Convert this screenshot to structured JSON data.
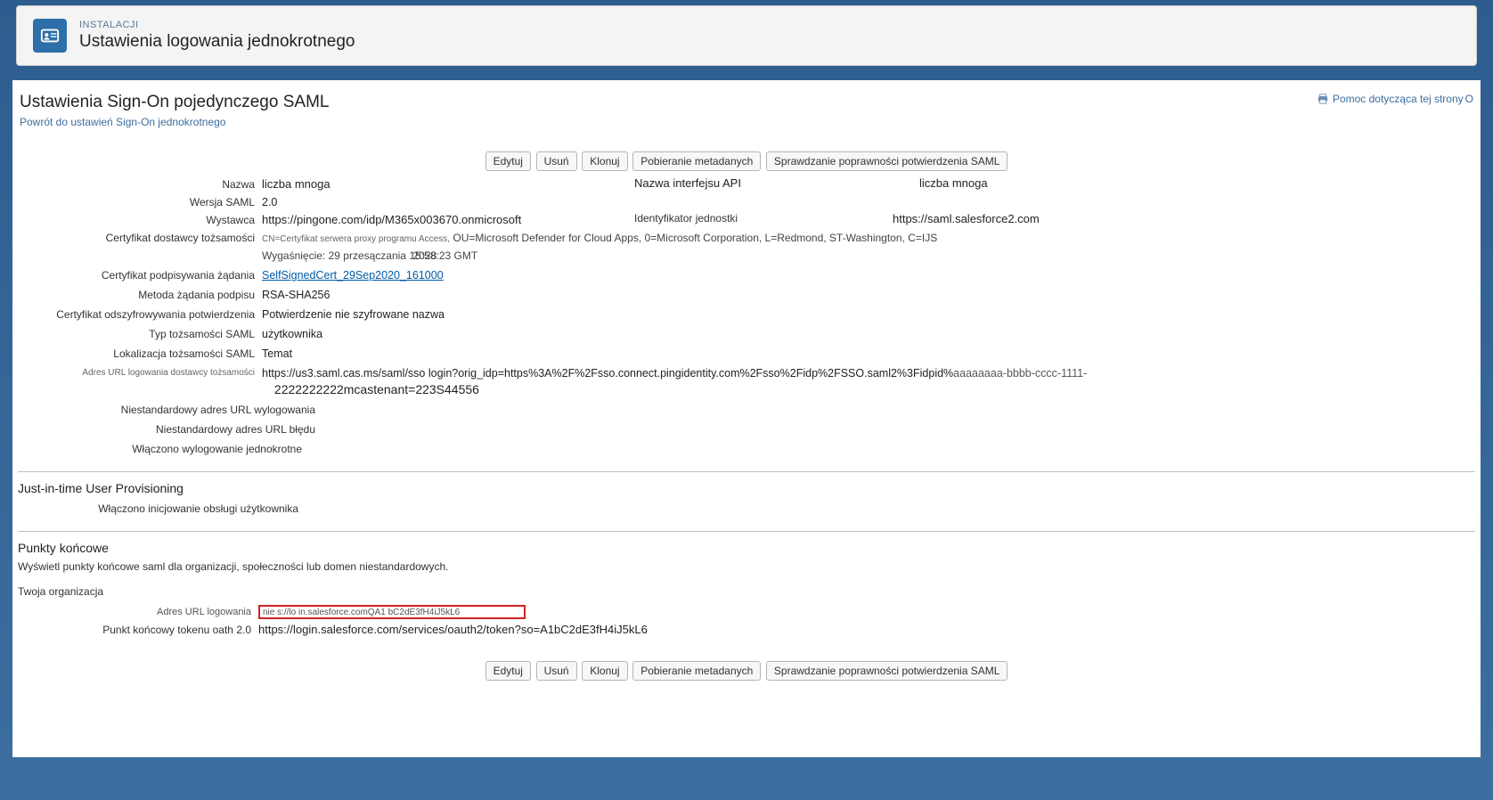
{
  "header": {
    "super": "INSTALACJI",
    "title": "Ustawienia logowania jednokrotnego"
  },
  "page": {
    "title": "Ustawienia Sign-On pojedynczego SAML",
    "back": "Powrót do ustawień Sign-On jednokrotnego",
    "help": "Pomoc dotycząca tej strony"
  },
  "buttons": {
    "edit": "Edytuj",
    "delete": "Usuń",
    "clone": "Klonuj",
    "download": "Pobieranie metadanych",
    "validate": "Sprawdzanie poprawności potwierdzenia SAML"
  },
  "fields": {
    "name_label": "Nazwa",
    "name_value": "liczba mnoga",
    "api_name_label": "Nazwa interfejsu API",
    "api_name_value": "liczba mnoga",
    "version_label": "Wersja SAML",
    "version_value": "2.0",
    "issuer_label": "Wystawca",
    "issuer_value": "https://pingone.com/idp/M365x003670.onmicrosoft",
    "entity_id_label": "Identyfikator jednostki",
    "entity_id_value": "https://saml.salesforce2.com",
    "idp_cert_label": "Certyfikat dostawcy tożsamości",
    "idp_cert_cn": "CN=Certyfikat serwera proxy programu Access,",
    "idp_cert_rest": "OU=Microsoft Defender for Cloud Apps, 0=Microsoft Corporation, L=Redmond, ST-Washington, C=IJS",
    "idp_cert_expiry_prefix": "Wygaśnięcie: 29 przesączania",
    "idp_cert_expiry_mid": "15:58:23 GMT",
    "idp_cert_expiry_year": "2028",
    "req_sign_cert_label": "Certyfikat podpisywania żądania",
    "req_sign_cert_value": "SelfSignedCert_29Sep2020_161000",
    "req_sig_method_label": "Metoda żądania podpisu",
    "req_sig_method_value": "RSA-SHA256",
    "assertion_decrypt_label": "Certyfikat odszyfrowywania potwierdzenia",
    "assertion_decrypt_value": "Potwierdzenie nie szyfrowane nazwa",
    "identity_type_label": "Typ tożsamości SAML",
    "identity_type_value": "użytkownika",
    "identity_loc_label": "Lokalizacja tożsamości SAML",
    "identity_loc_value": "Temat",
    "login_url_label": "Adres URL logowania dostawcy tożsamości",
    "login_url_value_a": "https://us3.saml.cas.ms/saml/sso login?orig_idp=https%3A%2F%2Fsso.connect.pingidentity.com%2Fsso%2Fidp%2FSSO.saml2%3Fidpid%",
    "login_url_value_b": "aaaaaaaa-bbbb-cccc-1111-",
    "login_url_value_c": "2222222222mcastenant=223S44556",
    "custom_logout_label": "Niestandardowy adres URL wylogowania",
    "custom_error_label": "Niestandardowy adres URL błędu",
    "slo_enabled_label": "Włączono wylogowanie jednokrotne"
  },
  "jit": {
    "heading": "Just-in-time User Provisioning",
    "enabled_label": "Włączono inicjowanie obsługi użytkownika"
  },
  "endpoints": {
    "heading": "Punkty końcowe",
    "sub": "Wyświetl punkty końcowe saml dla organizacji, społeczności lub domen niestandardowych.",
    "org": "Twoja organizacja",
    "login_url_label": "Adres URL logowania",
    "login_url_value": "nie s://lo in.salesforce.comQA1 bC2dE3fH4iJ5kL6",
    "oauth_label": "Punkt końcowy tokenu oath 2.0",
    "oauth_value": "https://login.salesforce.com/services/oauth2/token?so=A1bC2dE3fH4iJ5kL6"
  }
}
